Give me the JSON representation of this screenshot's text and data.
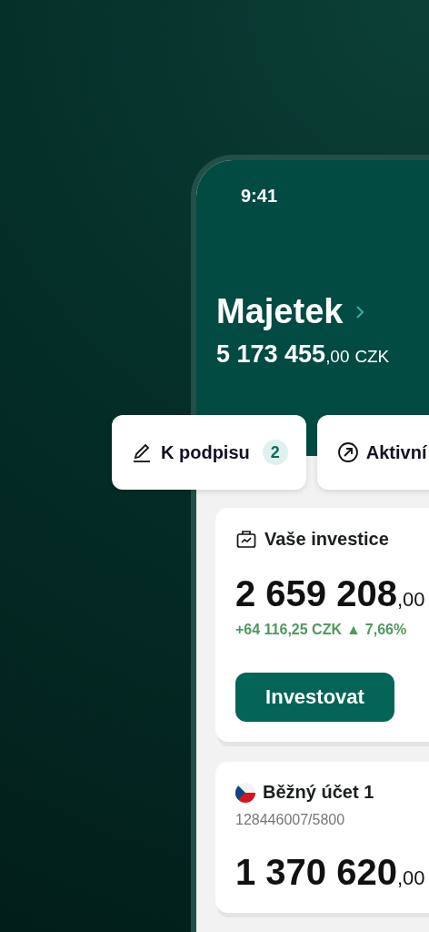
{
  "status_bar": {
    "time": "9:41"
  },
  "header": {
    "title": "Majetek",
    "amount": "5 173 455",
    "decimals": ",00",
    "currency": "CZK"
  },
  "chips": [
    {
      "kind": "sign",
      "label": "K podpisu",
      "count": "2"
    },
    {
      "kind": "active",
      "label": "Aktivní"
    }
  ],
  "cards": [
    {
      "kind": "investment",
      "title": "Vaše investice",
      "amount": "2 659 208",
      "decimals": ",00",
      "change": "+64 116,25 CZK",
      "trend": "▲",
      "percent": "7,66%",
      "button": "Investovat"
    },
    {
      "kind": "account",
      "title": "Běžný účet 1",
      "number": "128446007/5800",
      "amount": "1 370 620",
      "decimals": ",00"
    }
  ]
}
